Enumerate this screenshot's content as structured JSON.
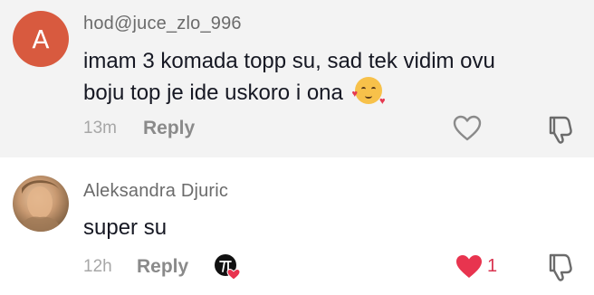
{
  "comments": [
    {
      "avatar_letter": "A",
      "username": "hod@juce_zlo_996",
      "text_line1": "imam 3 komada topp su, sad tek vidim ovu",
      "text_line2": "boju top je ide uskoro i ona",
      "emoji": "smiling-face-with-hearts",
      "time": "13m",
      "reply_label": "Reply",
      "liked": false
    },
    {
      "username": "Aleksandra Djuric",
      "text": "super su",
      "time": "12h",
      "reply_label": "Reply",
      "liked": true,
      "like_count": "1",
      "liked_by_creator": true
    }
  ],
  "colors": {
    "avatar_bg": "#d85a3f",
    "like_red": "#e8344f",
    "highlight_bg": "#f3f3f3"
  }
}
